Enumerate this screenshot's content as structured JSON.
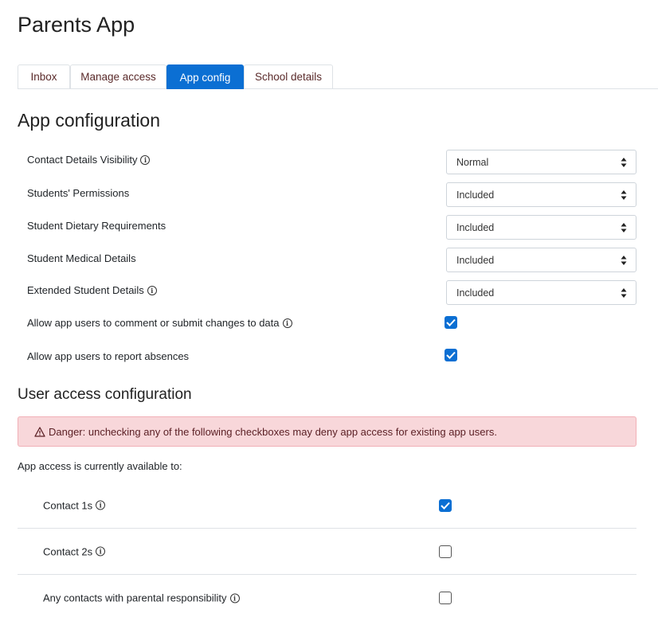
{
  "page_title": "Parents App",
  "tabs": [
    {
      "label": "Inbox",
      "active": false
    },
    {
      "label": "Manage access",
      "active": false
    },
    {
      "label": "App config",
      "active": true
    },
    {
      "label": "School details",
      "active": false
    }
  ],
  "app_config": {
    "title": "App configuration",
    "settings": [
      {
        "label": "Contact Details Visibility",
        "value": "Normal",
        "info": true
      },
      {
        "label": "Students' Permissions",
        "value": "Included",
        "info": false
      },
      {
        "label": "Student Dietary Requirements",
        "value": "Included",
        "info": false
      },
      {
        "label": "Student Medical Details",
        "value": "Included",
        "info": false
      },
      {
        "label": "Extended Student Details",
        "value": "Included",
        "info": true
      }
    ],
    "toggles": [
      {
        "label": "Allow app users to comment or submit changes to data",
        "checked": true,
        "info": true
      },
      {
        "label": "Allow app users to report absences",
        "checked": true,
        "info": false
      }
    ]
  },
  "user_access": {
    "title": "User access configuration",
    "danger": "Danger: unchecking any of the following checkboxes may deny app access for existing app users.",
    "note": "App access is currently available to:",
    "rows": [
      {
        "label": "Contact 1s",
        "checked": true,
        "info": true
      },
      {
        "label": "Contact 2s",
        "checked": false,
        "info": true
      },
      {
        "label": "Any contacts with parental responsibility",
        "checked": false,
        "info": true
      }
    ]
  },
  "info_glyph": "i",
  "colors": {
    "primary": "#0b6fd3",
    "danger_bg": "#f8d7da",
    "danger_text": "#5b2025"
  }
}
